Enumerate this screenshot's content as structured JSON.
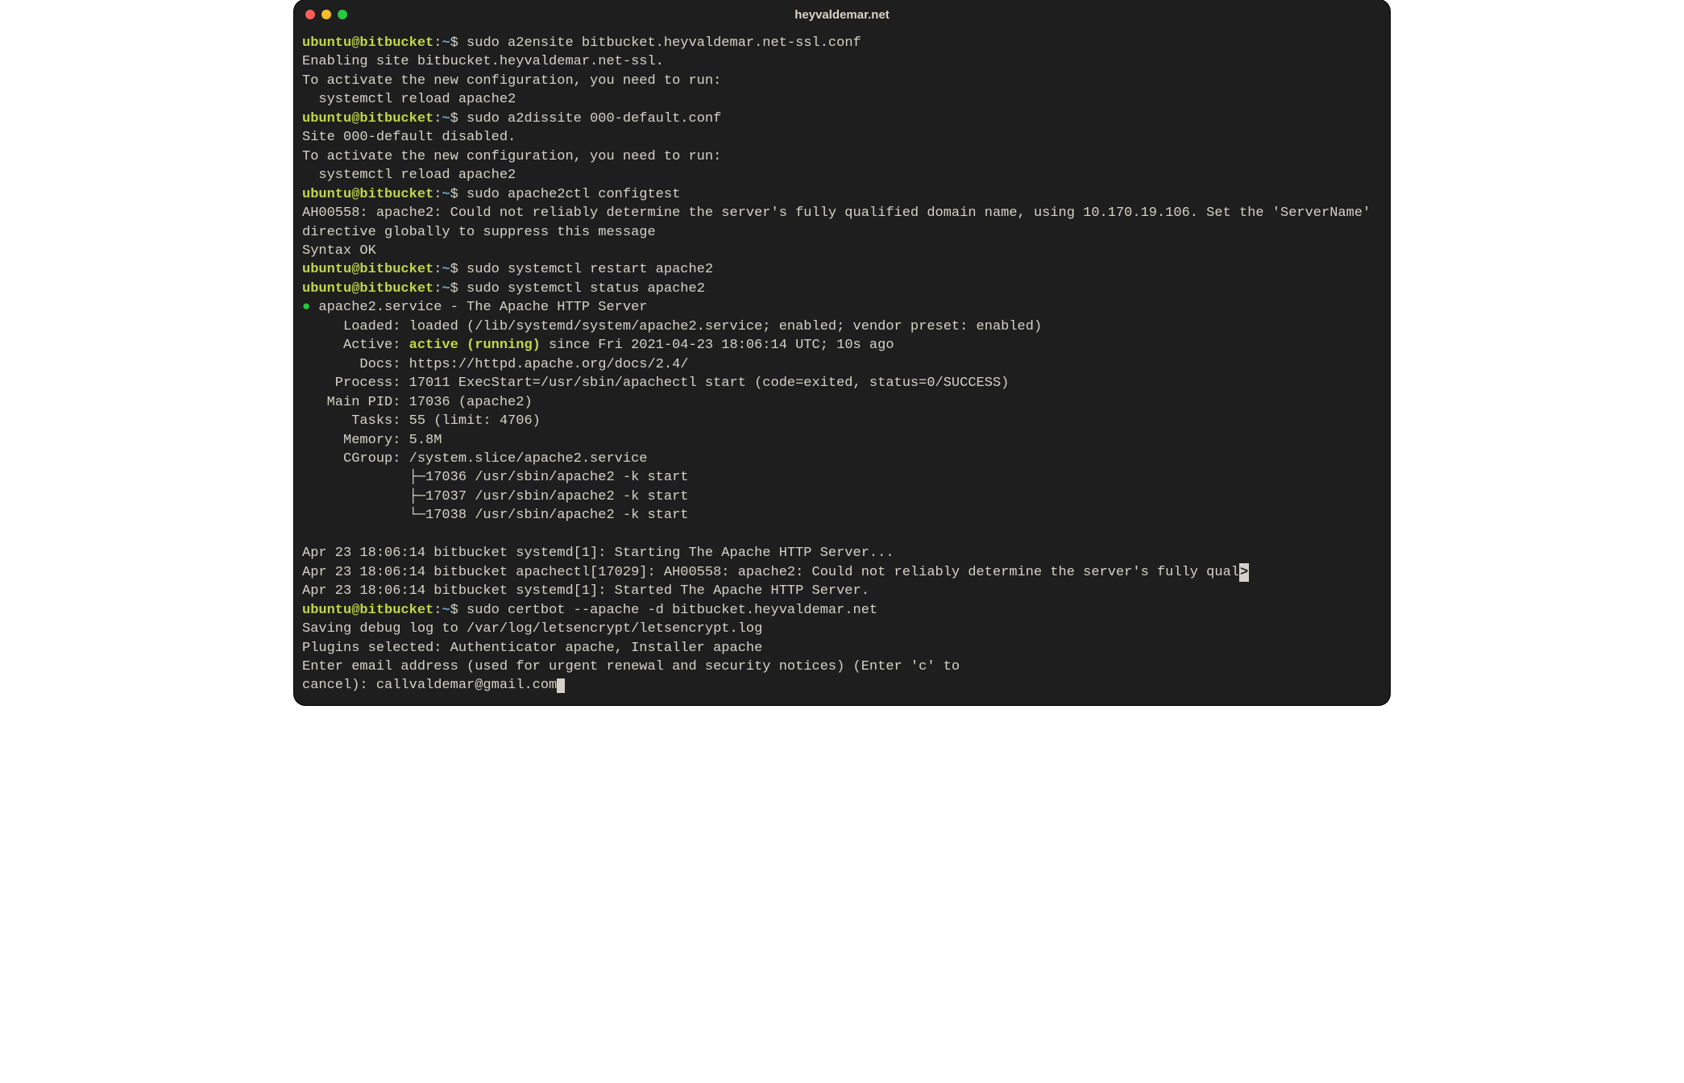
{
  "window": {
    "title": "heyvaldemar.net"
  },
  "prompt": {
    "user_host": "ubuntu@bitbucket",
    "sep": ":",
    "path": "~",
    "marker": "$"
  },
  "commands": {
    "c1": "sudo a2ensite bitbucket.heyvaldemar.net-ssl.conf",
    "c2": "sudo a2dissite 000-default.conf",
    "c3": "sudo apache2ctl configtest",
    "c4": "sudo systemctl restart apache2",
    "c5": "sudo systemctl status apache2",
    "c6": "sudo certbot --apache -d bitbucket.heyvaldemar.net"
  },
  "out": {
    "a2ensite1": "Enabling site bitbucket.heyvaldemar.net-ssl.",
    "activate_msg1": "To activate the new configuration, you need to run:",
    "activate_msg2": "  systemctl reload apache2",
    "a2dissite1": "Site 000-default disabled.",
    "ah00558": "AH00558: apache2: Could not reliably determine the server's fully qualified domain name, using 10.170.19.106. Set the 'ServerName' directive globally to suppress this message",
    "syntax_ok": "Syntax OK",
    "status_dot": "●",
    "status_head": " apache2.service - The Apache HTTP Server",
    "status_loaded": "     Loaded: loaded (/lib/systemd/system/apache2.service; enabled; vendor preset: enabled)",
    "status_active1": "     Active: ",
    "status_active2": "active (running)",
    "status_active3": " since Fri 2021-04-23 18:06:14 UTC; 10s ago",
    "status_docs": "       Docs: https://httpd.apache.org/docs/2.4/",
    "status_process": "    Process: 17011 ExecStart=/usr/sbin/apachectl start (code=exited, status=0/SUCCESS)",
    "status_mainpid": "   Main PID: 17036 (apache2)",
    "status_tasks": "      Tasks: 55 (limit: 4706)",
    "status_memory": "     Memory: 5.8M",
    "status_cgroup": "     CGroup: /system.slice/apache2.service",
    "status_cg1": "             ├─17036 /usr/sbin/apache2 -k start",
    "status_cg2": "             ├─17037 /usr/sbin/apache2 -k start",
    "status_cg3": "             └─17038 /usr/sbin/apache2 -k start",
    "log_blank": "",
    "log1": "Apr 23 18:06:14 bitbucket systemd[1]: Starting The Apache HTTP Server...",
    "log2a": "Apr 23 18:06:14 bitbucket apachectl[17029]: AH00558: apache2: Could not reliably determine the server's fully qual",
    "log2b": ">",
    "log3": "Apr 23 18:06:14 bitbucket systemd[1]: Started The Apache HTTP Server.",
    "certbot1": "Saving debug log to /var/log/letsencrypt/letsencrypt.log",
    "certbot2": "Plugins selected: Authenticator apache, Installer apache",
    "certbot3": "Enter email address (used for urgent renewal and security notices) (Enter 'c' to",
    "certbot4": "cancel): callvaldemar@gmail.com"
  }
}
